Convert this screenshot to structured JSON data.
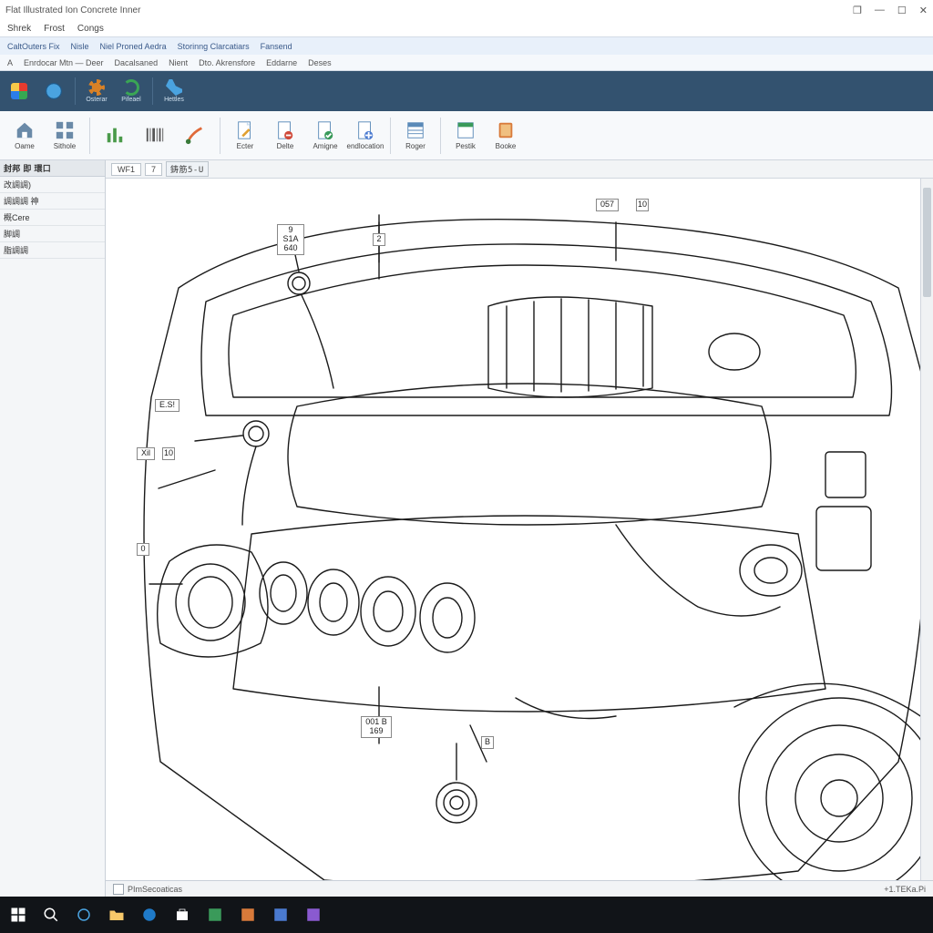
{
  "window": {
    "title": "Flat Illustrated Ion Concrete Inner",
    "controls": {
      "restore_down": "❐",
      "minimize": "—",
      "maximize": "☐",
      "close": "✕"
    }
  },
  "menubar": [
    "Shrek",
    "Frost",
    "Congs"
  ],
  "ribbon_tabs": [
    "CaltOuters Fix",
    "Nisle",
    "Niel Proned Aedra",
    "Storinng Clarcatiars",
    "Fansend"
  ],
  "ribbon_tabs2": [
    "A",
    "Enrdocar Mtn — Deer",
    "Dacalsaned",
    "Nient",
    "Dto. Akrensfore",
    "Eddarne",
    "Deses"
  ],
  "dark_toolbar": {
    "items": [
      {
        "name": "apps-tool",
        "color1": "#e63b2e",
        "color2": "#36a852",
        "color3": "#2b7de9",
        "color4": "#f7c948",
        "label": ""
      },
      {
        "name": "globe-tool",
        "color": "#2b7de9",
        "label": ""
      }
    ],
    "group2": [
      {
        "name": "gear-tool",
        "color": "#d98126",
        "label": "Osterar"
      },
      {
        "name": "recycle-tool",
        "color": "#3aa655",
        "label": "Pifeael"
      }
    ],
    "group3": [
      {
        "name": "phone-tool",
        "color": "#4aa3e0",
        "label": "Hettles"
      }
    ]
  },
  "light_toolbar": {
    "group1": [
      {
        "name": "home-tool",
        "icon": "home",
        "label": "Oame"
      },
      {
        "name": "grid-tool",
        "icon": "grid",
        "label": "Sithole"
      }
    ],
    "group2": [
      {
        "name": "chart-tool",
        "icon": "chart",
        "label": ""
      },
      {
        "name": "barcode-tool",
        "icon": "barcode",
        "label": ""
      },
      {
        "name": "brush-tool",
        "icon": "brush",
        "label": ""
      }
    ],
    "group3": [
      {
        "name": "edit-tool",
        "icon": "doc-edit",
        "label": "Ecter"
      },
      {
        "name": "delete-tool",
        "icon": "doc-del",
        "label": "Delte"
      },
      {
        "name": "assign-tool",
        "icon": "doc-asg",
        "label": "Amigne"
      },
      {
        "name": "endlocation-tool",
        "icon": "doc-end",
        "label": "endlocation"
      }
    ],
    "group4": [
      {
        "name": "roger-tool",
        "icon": "sheet",
        "label": "Roger"
      }
    ],
    "group5": [
      {
        "name": "print-tool",
        "icon": "sheet-p",
        "label": "Pestik"
      },
      {
        "name": "book-tool",
        "icon": "book",
        "label": "Booke"
      }
    ]
  },
  "side_panel": {
    "header": "封邦 即 環口",
    "items": [
      "改調調)",
      "調調調 神",
      "概Cere",
      "脚調",
      "脂調調"
    ]
  },
  "doc_tabs": {
    "tab1": "WF1",
    "tab2": "7",
    "badge": "鋳筋5-U"
  },
  "callouts": {
    "c1": "057",
    "c1b": "10",
    "c2a": "9 S1A",
    "c2b": "640",
    "c3": "2",
    "c4": "E.S!",
    "c5a": "Xil",
    "c5b": "10",
    "c6": "0",
    "c7a": "001 B",
    "c7b": "169",
    "c8": "B"
  },
  "statusbar": {
    "left": "PImSecoaticas",
    "right": "+1.TEKa.Pi"
  },
  "taskbar": {
    "items": [
      "start",
      "search",
      "cortana",
      "folder",
      "edge",
      "store",
      "app1",
      "app2",
      "app3",
      "app4"
    ],
    "clock": ""
  },
  "colors": {
    "dark_toolbar": "#33526f",
    "ribbon_bg": "#e8f0fa",
    "panel_bg": "#f4f6f8"
  }
}
